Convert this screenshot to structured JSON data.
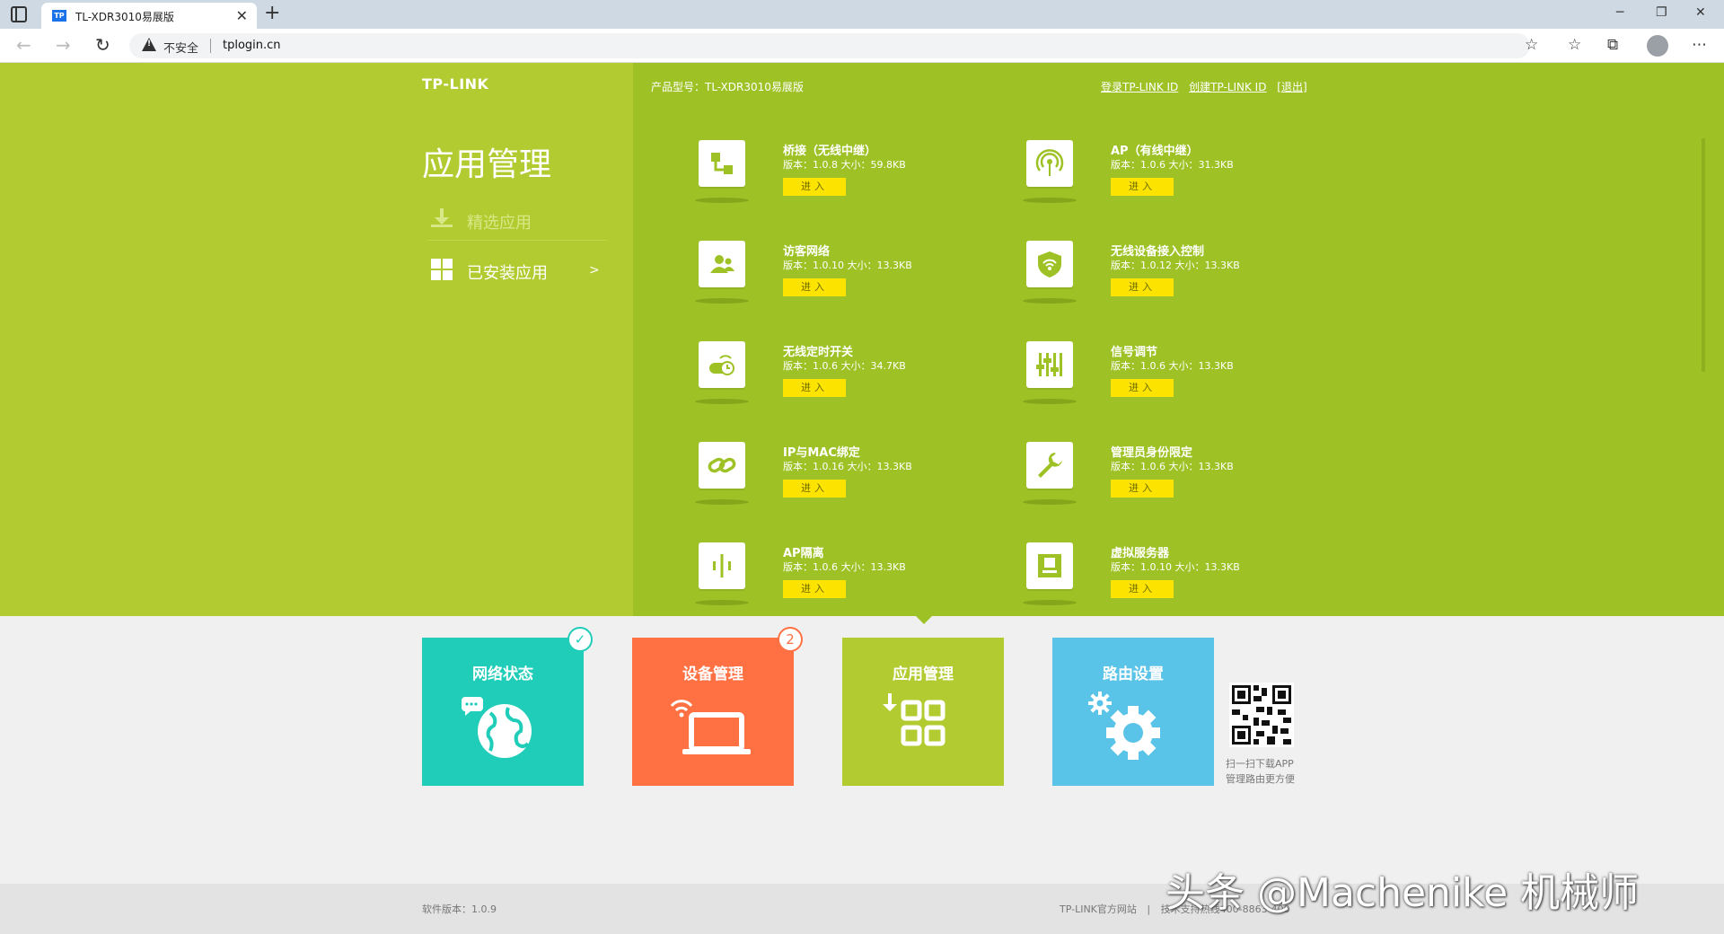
{
  "browser": {
    "tab_title": "TL-XDR3010易展版",
    "favicon_text": "TP",
    "insecure_label": "不安全",
    "url": "tplogin.cn"
  },
  "header": {
    "logo": "TP-LINK",
    "product_model": "产品型号：TL-XDR3010易展版",
    "login_link": "登录TP-LINK ID",
    "create_link": "创建TP-LINK ID",
    "logout_link": "[退出]"
  },
  "sidebar": {
    "title": "应用管理",
    "items": [
      {
        "label": "精选应用",
        "icon": "download-icon"
      },
      {
        "label": "已安装应用",
        "icon": "grid-icon",
        "chevron": ">"
      }
    ]
  },
  "apps": [
    {
      "name": "桥接（无线中继）",
      "meta": "版本：1.0.8 大小：59.8KB",
      "button": "进入",
      "icon": "bridge-icon"
    },
    {
      "name": "AP（有线中继）",
      "meta": "版本：1.0.6 大小：31.3KB",
      "button": "进入",
      "icon": "ap-icon"
    },
    {
      "name": "访客网络",
      "meta": "版本：1.0.10 大小：13.3KB",
      "button": "进入",
      "icon": "guest-network-icon"
    },
    {
      "name": "无线设备接入控制",
      "meta": "版本：1.0.12 大小：13.3KB",
      "button": "进入",
      "icon": "access-control-icon"
    },
    {
      "name": "无线定时开关",
      "meta": "版本：1.0.6 大小：34.7KB",
      "button": "进入",
      "icon": "wifi-timer-icon"
    },
    {
      "name": "信号调节",
      "meta": "版本：1.0.6 大小：13.3KB",
      "button": "进入",
      "icon": "signal-adjust-icon"
    },
    {
      "name": "IP与MAC绑定",
      "meta": "版本：1.0.16 大小：13.3KB",
      "button": "进入",
      "icon": "link-icon"
    },
    {
      "name": "管理员身份限定",
      "meta": "版本：1.0.6 大小：13.3KB",
      "button": "进入",
      "icon": "wrench-icon"
    },
    {
      "name": "AP隔离",
      "meta": "版本：1.0.6 大小：13.3KB",
      "button": "进入",
      "icon": "ap-isolation-icon"
    },
    {
      "name": "虚拟服务器",
      "meta": "版本：1.0.10 大小：13.3KB",
      "button": "进入",
      "icon": "server-icon"
    }
  ],
  "tiles": [
    {
      "title": "网络状态",
      "color": "#1fcdb8",
      "badge": "✓",
      "icon": "globe-icon"
    },
    {
      "title": "设备管理",
      "color": "#ff7043",
      "badge": "2",
      "icon": "laptop-icon"
    },
    {
      "title": "应用管理",
      "color": "#b1cb30",
      "icon": "apps-icon"
    },
    {
      "title": "路由设置",
      "color": "#59c3e8",
      "icon": "gear-icon"
    }
  ],
  "qr": {
    "line1": "扫一扫下载APP",
    "line2": "管理路由更方便"
  },
  "footer": {
    "version": "软件版本：1.0.9",
    "site": "TP-LINK官方网站",
    "support": "技术支持热线400-8863-400"
  },
  "watermark": "头条 @Machenike 机械师"
}
